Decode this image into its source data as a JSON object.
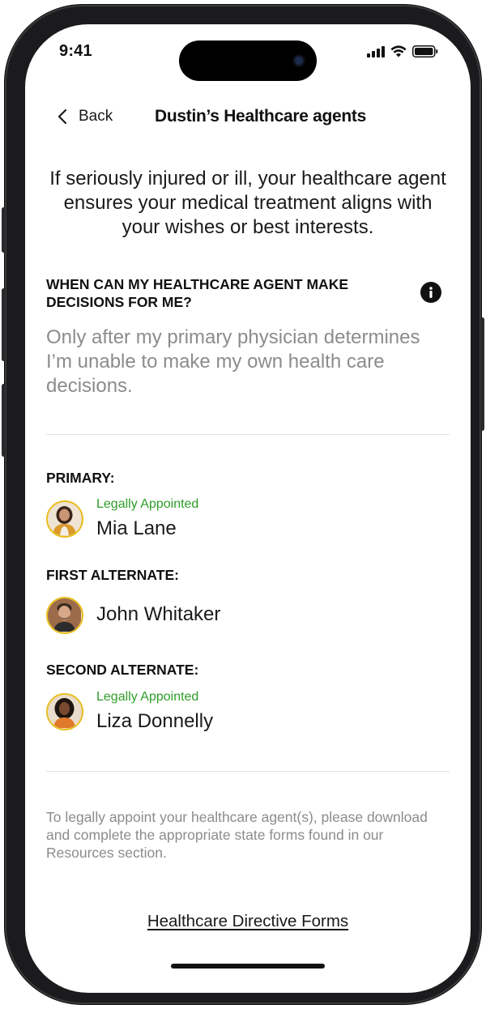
{
  "status_bar": {
    "time": "9:41"
  },
  "nav": {
    "back_label": "Back",
    "title": "Dustin’s Healthcare agents"
  },
  "intro": "If seriously injured or ill, your healthcare agent ensures your medical treatment aligns with your wishes or best interests.",
  "decision": {
    "question": "WHEN CAN MY HEALTHCARE AGENT MAKE DECISIONS FOR ME?",
    "answer": "Only after my primary physician determines I’m unable to make my own health care decisions."
  },
  "agents": [
    {
      "role": "PRIMARY:",
      "badge": "Legally Appointed",
      "name": "Mia Lane"
    },
    {
      "role": "FIRST ALTERNATE:",
      "badge": "",
      "name": "John Whitaker"
    },
    {
      "role": "SECOND ALTERNATE:",
      "badge": "Legally Appointed",
      "name": "Liza Donnelly"
    }
  ],
  "footnote": "To legally appoint your healthcare agent(s), please download and complete the appropriate state forms found in our Resources section.",
  "link_label": "Healthcare Directive Forms",
  "colors": {
    "accent_green": "#2e9d28",
    "avatar_ring": "#e8bf1f",
    "muted_text": "#8c8c8c"
  },
  "icons": [
    "chevron-left-icon",
    "info-icon",
    "cellular-signal-icon",
    "wifi-icon",
    "battery-icon"
  ]
}
